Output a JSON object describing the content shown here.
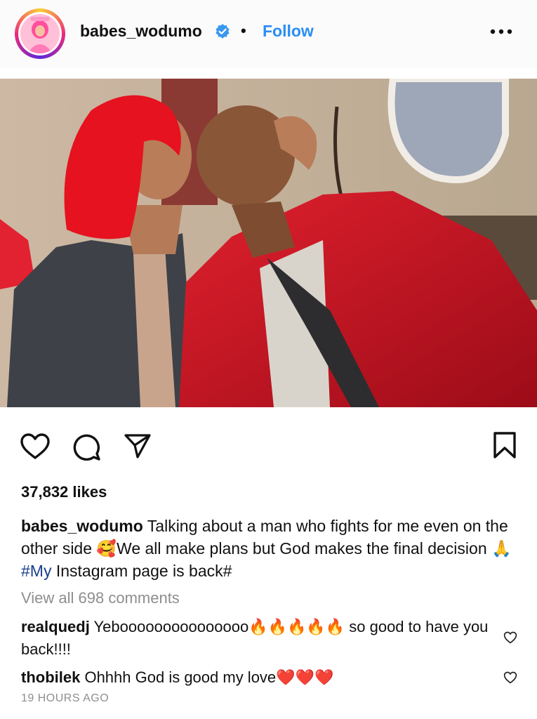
{
  "header": {
    "username": "babes_wodumo",
    "separator": "•",
    "follow_label": "Follow",
    "verified_icon": "verified-badge-icon",
    "more_icon": "more-options-icon"
  },
  "post": {
    "photo_alt": "Photo of a woman with red hair kissing a man in a red leather jacket"
  },
  "actions": {
    "like_icon": "heart-icon",
    "comment_icon": "comment-icon",
    "share_icon": "send-icon",
    "save_icon": "bookmark-icon"
  },
  "likes": "37,832 likes",
  "caption": {
    "username": "babes_wodumo",
    "text_1": " Talking about a man who fights for me even on the other side 🥰We all make plans but God makes the final decision 🙏",
    "hashtag": "#My",
    "text_2": " Instagram page is back#"
  },
  "view_all_comments": "View all 698 comments",
  "comments": [
    {
      "username": "realquedj",
      "text": " Yebooooooooooooooo🔥🔥🔥🔥🔥 so good to have you back!!!!"
    },
    {
      "username": "thobilek",
      "text": " Ohhhh God is good my love❤️❤️❤️"
    }
  ],
  "timestamp": "19 HOURS AGO",
  "colors": {
    "link_blue": "#2a8df5",
    "hashtag_blue": "#1b3f8c",
    "muted_gray": "#8e8e8e"
  }
}
